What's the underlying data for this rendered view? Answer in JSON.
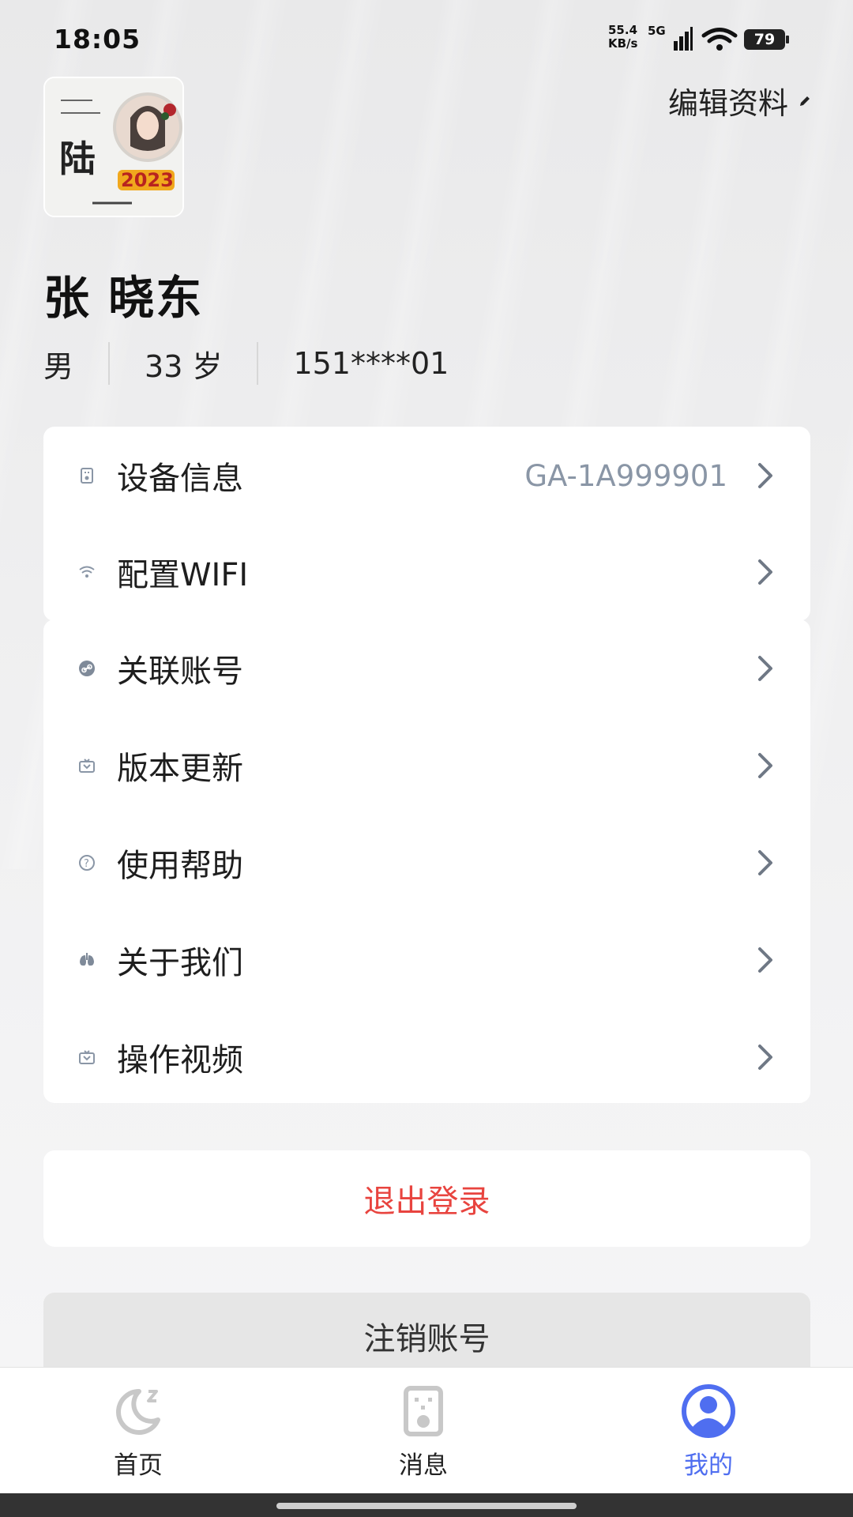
{
  "status_bar": {
    "time": "18:05",
    "net_speed_value": "55.4",
    "net_speed_unit": "KB/s",
    "network_type": "5G",
    "battery": "79"
  },
  "profile": {
    "edit_label": "编辑资料",
    "name": "张 晓东",
    "gender": "男",
    "age": "33 岁",
    "phone": "151****01",
    "avatar_text": "陆",
    "avatar_year": "2023"
  },
  "settings": {
    "group1": [
      {
        "label": "设备信息",
        "value": "GA-1A999901",
        "icon": "device-icon"
      },
      {
        "label": "配置WIFI",
        "value": "",
        "icon": "wifi-icon"
      }
    ],
    "group2": [
      {
        "label": "关联账号",
        "icon": "link-icon"
      },
      {
        "label": "版本更新",
        "icon": "update-icon"
      },
      {
        "label": "使用帮助",
        "icon": "help-icon"
      },
      {
        "label": "关于我们",
        "icon": "lungs-icon"
      },
      {
        "label": "操作视频",
        "icon": "video-icon"
      }
    ]
  },
  "actions": {
    "logout": "退出登录",
    "cancel_account": "注销账号"
  },
  "tabs": [
    {
      "label": "首页",
      "icon": "moon-sleep-icon",
      "active": false
    },
    {
      "label": "消息",
      "icon": "message-device-icon",
      "active": false
    },
    {
      "label": "我的",
      "icon": "user-icon",
      "active": true
    }
  ],
  "colors": {
    "accent": "#4f6ef0",
    "danger": "#e8443f",
    "muted_value": "#8a96a6"
  }
}
